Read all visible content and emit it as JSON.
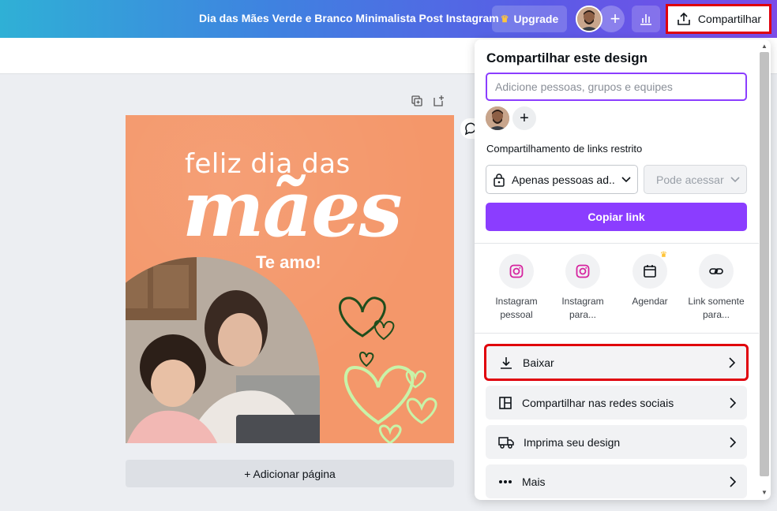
{
  "topbar": {
    "doc_title": "Dia das Mães Verde e Branco Minimalista Post Instagram",
    "upgrade_label": "Upgrade",
    "add_icon": "+",
    "share_label": "Compartilhar"
  },
  "canvas": {
    "design_text_1": "feliz dia das",
    "design_text_2": "mães",
    "design_text_3": "Te amo!",
    "add_page_label": "+ Adicionar página"
  },
  "share_panel": {
    "title": "Compartilhar este design",
    "people_placeholder": "Adicione pessoas, grupos e equipes",
    "add_member_icon": "+",
    "link_label": "Compartilhamento de links restrito",
    "access_value": "Apenas pessoas ad...",
    "permission_value": "Pode acessar",
    "copy_link_label": "Copiar link",
    "options": [
      {
        "label": "Instagram pessoal",
        "icon": "instagram-icon"
      },
      {
        "label": "Instagram para...",
        "icon": "instagram-icon"
      },
      {
        "label": "Agendar",
        "icon": "calendar-icon"
      },
      {
        "label": "Link somente para...",
        "icon": "link-icon"
      }
    ],
    "actions": [
      {
        "label": "Baixar",
        "icon": "download-icon"
      },
      {
        "label": "Compartilhar nas redes sociais",
        "icon": "social-layout-icon"
      },
      {
        "label": "Imprima seu design",
        "icon": "truck-icon"
      },
      {
        "label": "Mais",
        "icon": "more-icon"
      }
    ]
  },
  "colors": {
    "accent": "#8b3dff",
    "highlight_border": "#e0000b",
    "design_bg": "#f59a6b"
  }
}
